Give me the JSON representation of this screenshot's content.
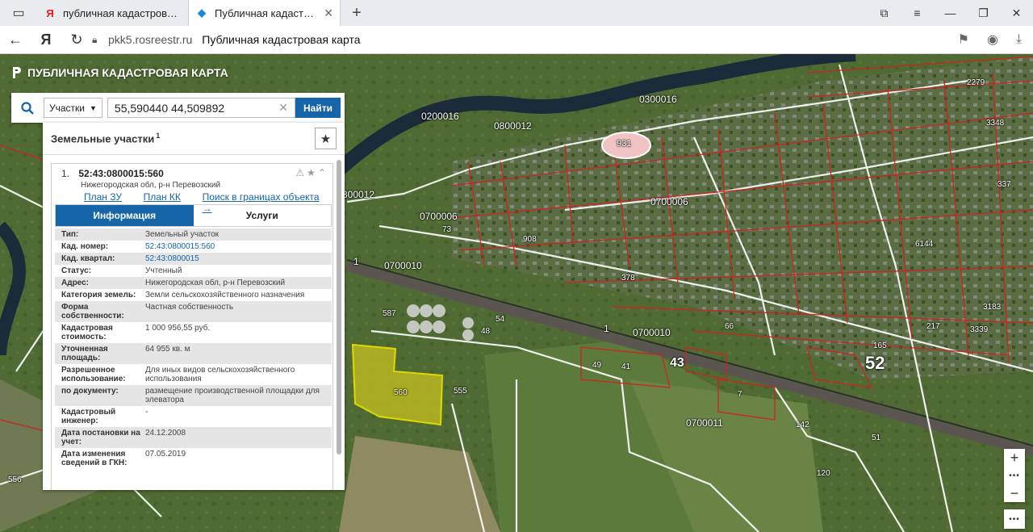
{
  "browser": {
    "tabs": [
      {
        "title": "публичная кадастровая к",
        "favicon": "Я"
      },
      {
        "title": "Публичная кадастровая к",
        "favicon": "◆"
      }
    ],
    "url_domain": "pkk5.rosreestr.ru",
    "page_title": "Публичная кадастровая карта"
  },
  "app": {
    "brand": "ПУБЛИЧНАЯ КАДАСТРОВАЯ КАРТА"
  },
  "search": {
    "category": "Участки",
    "query": "55,590440 44,509892",
    "button": "Найти"
  },
  "panel": {
    "heading": "Земельные участки",
    "count": "1",
    "item": {
      "index": "1.",
      "cad_number": "52:43:0800015:560",
      "address": "Нижегородская обл, р-н Перевозский",
      "links": [
        "План ЗУ →",
        "План КК →",
        "Поиск в границах объекта →"
      ],
      "tabs": [
        "Информация",
        "Услуги"
      ],
      "props": [
        {
          "k": "Тип:",
          "v": "Земельный участок"
        },
        {
          "k": "Кад. номер:",
          "v": "52:43:0800015:560"
        },
        {
          "k": "Кад. квартал:",
          "v": "52:43:0800015"
        },
        {
          "k": "Статус:",
          "v": "Учтенный"
        },
        {
          "k": "Адрес:",
          "v": "Нижегородская обл, р-н Перевозский"
        },
        {
          "k": "Категория земель:",
          "v": "Земли сельскохозяйственного назначения"
        },
        {
          "k": "Форма собственности:",
          "v": "Частная собственность"
        },
        {
          "k": "Кадастровая стоимость:",
          "v": "1 000 956,55 руб."
        },
        {
          "k": "Уточненная площадь:",
          "v": "64 955 кв. м"
        },
        {
          "k": "Разрешенное использование:",
          "v": "Для иных видов сельскохозяйственного использования"
        },
        {
          "k": "по документу:",
          "v": "размещение производственной площадки для элеватора"
        },
        {
          "k": "Кадастровый инженер:",
          "v": "-"
        },
        {
          "k": "Дата постановки на учет:",
          "v": "24.12.2008"
        },
        {
          "k": "Дата изменения сведений в ГКН:",
          "v": "07.05.2019"
        }
      ]
    }
  },
  "map": {
    "labels": [
      "0300016",
      "0200016",
      "0800012",
      "931",
      "0700006",
      "0700006",
      "73",
      "908",
      "0700010",
      "0700010",
      "1",
      "1",
      "587",
      "378",
      "54",
      "43",
      "52",
      "165",
      "560",
      "555",
      "49",
      "41",
      "7",
      "0700011",
      "142",
      "51",
      "120",
      "556",
      "6144",
      "217",
      "3183",
      "3339",
      "337",
      "2279",
      "3348",
      "66",
      "300012",
      "48"
    ],
    "zoom_in": "+",
    "zoom_out": "−",
    "more": "•••"
  }
}
